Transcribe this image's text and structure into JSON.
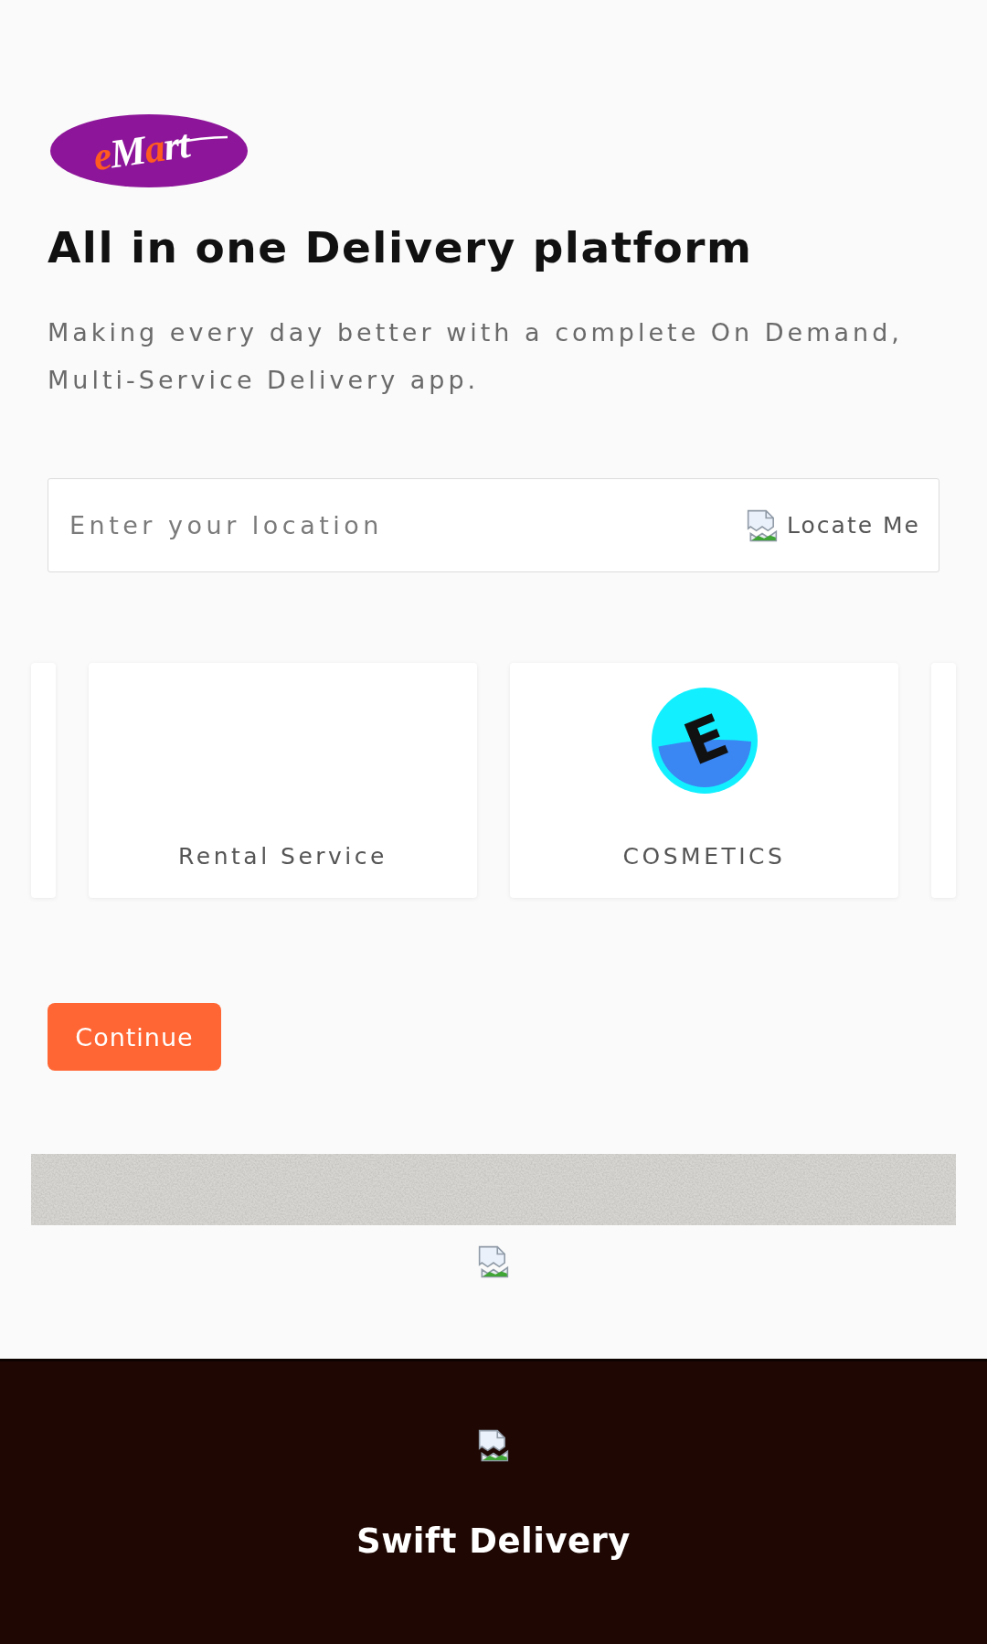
{
  "logo": {
    "parts": [
      {
        "text": "e",
        "color": "#ff5a1f"
      },
      {
        "text": "M",
        "color": "#ffffff"
      },
      {
        "text": "a",
        "color": "#ff5a1f"
      },
      {
        "text": "rt",
        "color": "#ffffff"
      }
    ]
  },
  "hero": {
    "title": "All in one Delivery platform",
    "subtitle": "Making every day better with a complete On Demand, Multi-Service Delivery app."
  },
  "location": {
    "placeholder": "Enter your location",
    "locate_button": "Locate Me"
  },
  "services": [
    {
      "kind": "clipped"
    },
    {
      "kind": "card",
      "label": "Rental Service"
    },
    {
      "kind": "card",
      "label": "COSMETICS",
      "logo": "E"
    },
    {
      "kind": "clipped"
    }
  ],
  "continue_button": "Continue",
  "footer": {
    "title": "Swift Delivery"
  }
}
